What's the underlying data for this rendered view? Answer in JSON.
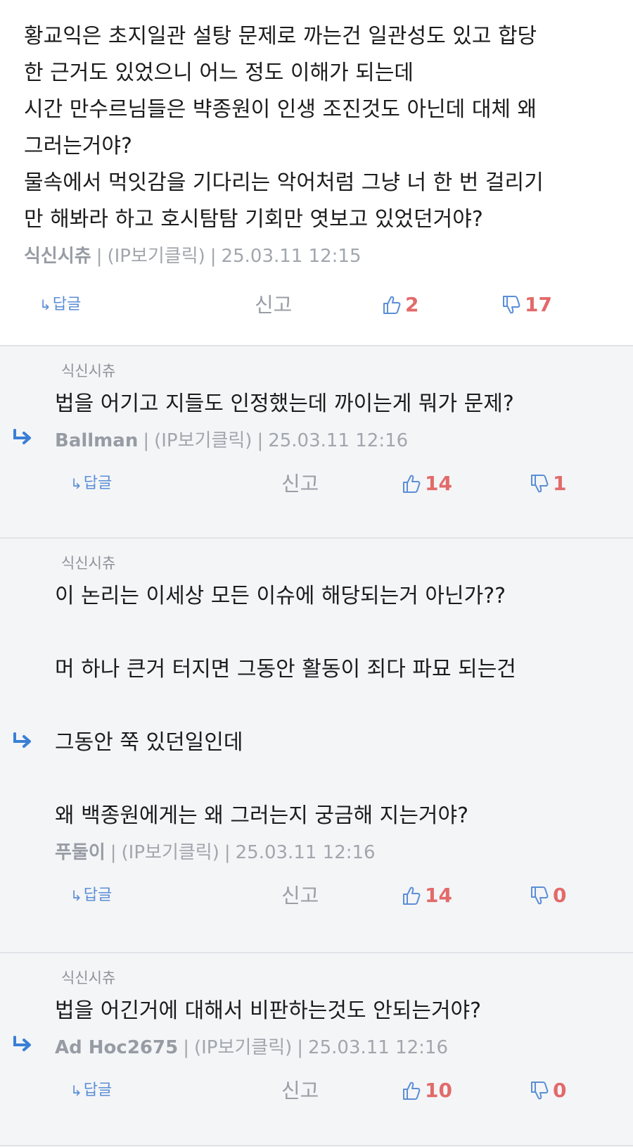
{
  "comments": [
    {
      "body": "황교익은 초지일관 설탕 문제로 까는건 일관성도 있고 합당\n한 근거도 있었으니 어느 정도 이해가 되는데\n시간 만수르님들은 뱍종원이 인생 조진것도 아닌데 대체 왜\n그러는거야?\n물속에서 먹잇감을 기다리는 악어처럼 그냥 너 한 번 걸리기\n만 해봐라 하고 호시탐탐 기회만 엿보고 있었던거야?",
      "author": "식신시츄",
      "ip": "(IP보기클릭)",
      "date": "25.03.11 12:15",
      "reply_label": "답글",
      "report_label": "신고",
      "up": "2",
      "down": "17"
    },
    {
      "mention": "식신시츄",
      "body": "법을 어기고 지들도 인정했는데 까이는게 뭐가 문제?",
      "author": "Ballman",
      "ip": "(IP보기클릭)",
      "date": "25.03.11 12:16",
      "reply_label": "답글",
      "report_label": "신고",
      "up": "14",
      "down": "1"
    },
    {
      "mention": "식신시츄",
      "body": "이 논리는 이세상 모든 이슈에 해당되는거 아닌가??\n\n머 하나 큰거 터지면 그동안 활동이 죄다 파묘 되는건\n\n그동안 쭉 있던일인데\n\n왜 백종원에게는 왜 그러는지 궁금해 지는거야?",
      "author": "푸둘이",
      "ip": "(IP보기클릭)",
      "date": "25.03.11 12:16",
      "reply_label": "답글",
      "report_label": "신고",
      "up": "14",
      "down": "0"
    },
    {
      "mention": "식신시츄",
      "body": "법을 어긴거에 대해서 비판하는것도 안되는거야?",
      "author": "Ad Hoc2675",
      "ip": "(IP보기클릭)",
      "date": "25.03.11 12:16",
      "reply_label": "답글",
      "report_label": "신고",
      "up": "10",
      "down": "0"
    }
  ],
  "colors": {
    "background": "#f4f5f7",
    "top_comment_bg": "#ffffff",
    "reply_link": "#5b8ed6",
    "vote_count": "#e26a6a",
    "meta_text": "#a2a6ad",
    "reply_arrow": "#3a7fd5"
  },
  "icons": {
    "reply_arrow": "reply-arrow-icon",
    "thumbs_up": "thumbs-up-icon",
    "thumbs_down": "thumbs-down-icon"
  }
}
